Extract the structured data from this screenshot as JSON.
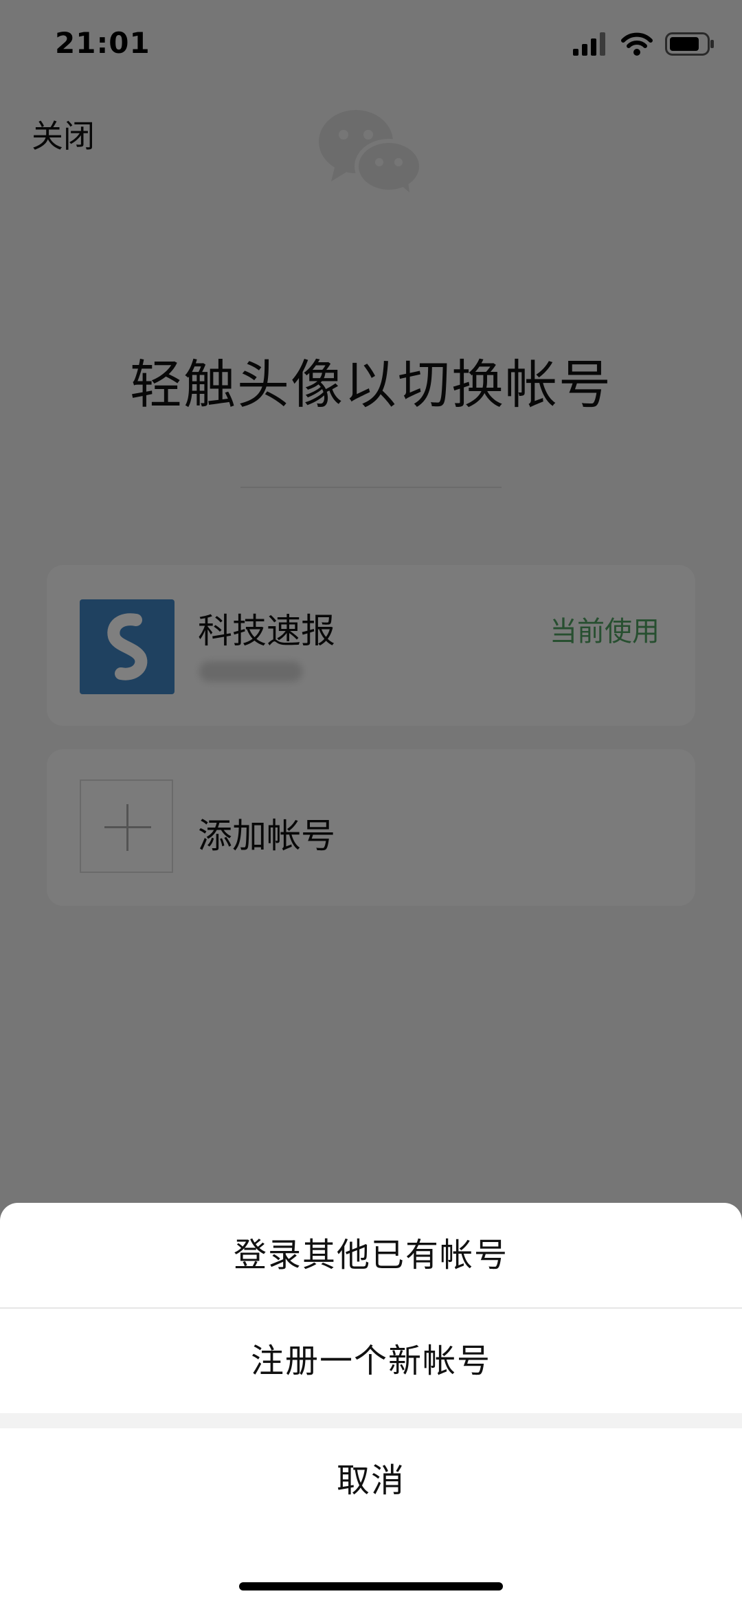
{
  "status_bar": {
    "time": "21:01",
    "icons": [
      "cellular-signal-icon",
      "wifi-icon",
      "battery-icon"
    ]
  },
  "header": {
    "close_label": "关闭",
    "logo_icon": "wechat-logo-icon"
  },
  "main": {
    "title": "轻触头像以切换帐号",
    "accounts": [
      {
        "name": "科技速报",
        "status": "当前使用",
        "avatar_icon": "account-avatar-logo-icon"
      }
    ],
    "add_account_label": "添加帐号"
  },
  "action_sheet": {
    "login_other": "登录其他已有帐号",
    "register_new": "注册一个新帐号",
    "cancel": "取消"
  },
  "colors": {
    "status_green": "#4f9e61",
    "avatar_blue": "#3e82c0",
    "overlay": "rgba(0,0,0,0.5)"
  }
}
